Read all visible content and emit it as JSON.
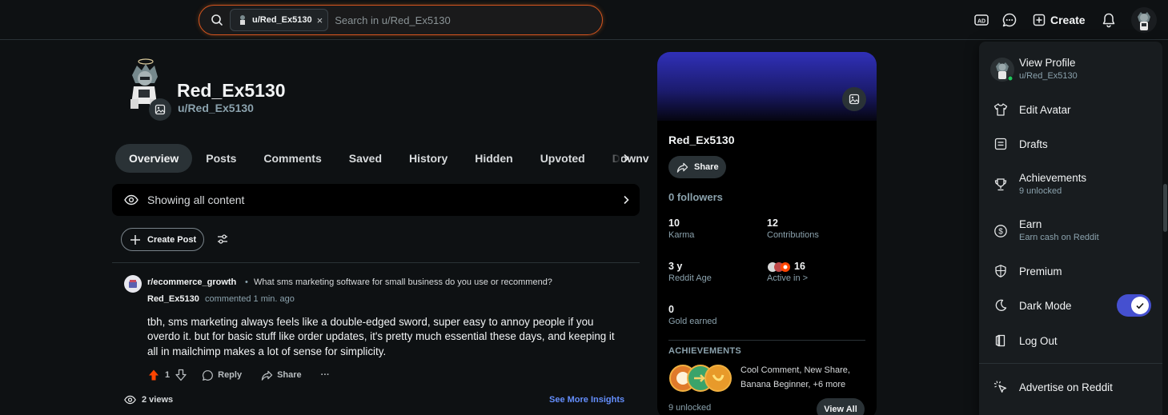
{
  "search": {
    "chip_label": "u/Red_Ex5130",
    "chip_close": "×",
    "placeholder": "Search in u/Red_Ex5130"
  },
  "header": {
    "create_label": "Create"
  },
  "profile": {
    "display_name": "Red_Ex5130",
    "handle": "u/Red_Ex5130"
  },
  "tabs": [
    "Overview",
    "Posts",
    "Comments",
    "Saved",
    "History",
    "Hidden",
    "Upvoted",
    "Downv"
  ],
  "filter": {
    "label": "Showing all content"
  },
  "create_post": {
    "label": "Create Post"
  },
  "comment": {
    "subreddit": "r/ecommerce_growth",
    "separator": "•",
    "post_title": "What sms marketing software for small business do you use or recommend?",
    "user": "Red_Ex5130",
    "meta": "commented 1 min. ago",
    "body": "tbh, sms marketing always feels like a double-edged sword, super easy to annoy people if you overdo it. but for basic stuff like order updates, it's pretty much essential these days, and keeping it all in mailchimp makes a lot of sense for simplicity.",
    "votes": "1",
    "reply": "Reply",
    "share": "Share",
    "more": "···",
    "views": "2 views",
    "insights": "See More Insights"
  },
  "card": {
    "name": "Red_Ex5130",
    "share": "Share",
    "followers": "0 followers",
    "karma_value": "10",
    "karma_label": "Karma",
    "contributions_value": "12",
    "contributions_label": "Contributions",
    "age_value": "3 y",
    "age_label": "Reddit Age",
    "active_value": "16",
    "active_label": "Active in >",
    "gold_value": "0",
    "gold_label": "Gold earned",
    "achievements_heading": "ACHIEVEMENTS",
    "achievements_text": "Cool Comment, New Share, Banana Beginner, +6 more",
    "unlocked": "9 unlocked",
    "view_all": "View All"
  },
  "menu": {
    "view_profile": "View Profile",
    "view_profile_sub": "u/Red_Ex5130",
    "edit_avatar": "Edit Avatar",
    "drafts": "Drafts",
    "achievements": "Achievements",
    "achievements_sub": "9 unlocked",
    "earn": "Earn",
    "earn_sub": "Earn cash on Reddit",
    "premium": "Premium",
    "dark_mode": "Dark Mode",
    "log_out": "Log Out",
    "advertise": "Advertise on Reddit"
  },
  "colors": {
    "accent_blue": "#648efc",
    "upvote_orange": "#ff4500",
    "search_border": "#d4541f",
    "toggle_on": "#4550d0"
  }
}
